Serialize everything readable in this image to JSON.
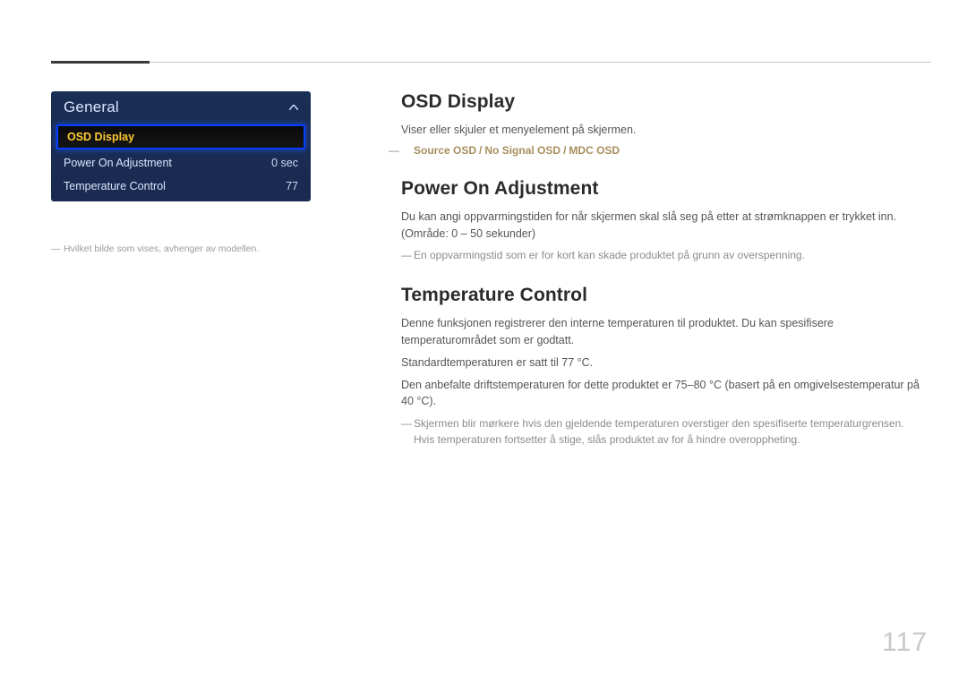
{
  "pageNumber": "117",
  "panel": {
    "title": "General",
    "rows": [
      {
        "label": "OSD Display",
        "value": "",
        "selected": true
      },
      {
        "label": "Power On Adjustment",
        "value": "0 sec",
        "selected": false
      },
      {
        "label": "Temperature Control",
        "value": "77",
        "selected": false
      }
    ]
  },
  "footnoteLeft": "Hvilket bilde som vises, avhenger av modellen.",
  "sections": {
    "osd": {
      "title": "OSD Display",
      "body": "Viser eller skjuler et menyelement på skjermen.",
      "options": [
        "Source OSD",
        "No Signal OSD",
        "MDC OSD"
      ]
    },
    "power": {
      "title": "Power On Adjustment",
      "body": "Du kan angi oppvarmingstiden for når skjermen skal slå seg på etter at strømknappen er trykket inn. (Område: 0 – 50 sekunder)",
      "note": "En oppvarmingstid som er for kort kan skade produktet på grunn av overspenning."
    },
    "temp": {
      "title": "Temperature Control",
      "body1": "Denne funksjonen registrerer den interne temperaturen til produktet. Du kan spesifisere temperaturområdet som er godtatt.",
      "body2": "Standardtemperaturen er satt til 77 °C.",
      "body3": "Den anbefalte driftstemperaturen for dette produktet er 75–80 °C (basert på en omgivelsestemperatur på 40 °C).",
      "note": "Skjermen blir mørkere hvis den gjeldende temperaturen overstiger den spesifiserte temperaturgrensen. Hvis temperaturen fortsetter å stige, slås produktet av for å hindre overoppheting."
    }
  }
}
